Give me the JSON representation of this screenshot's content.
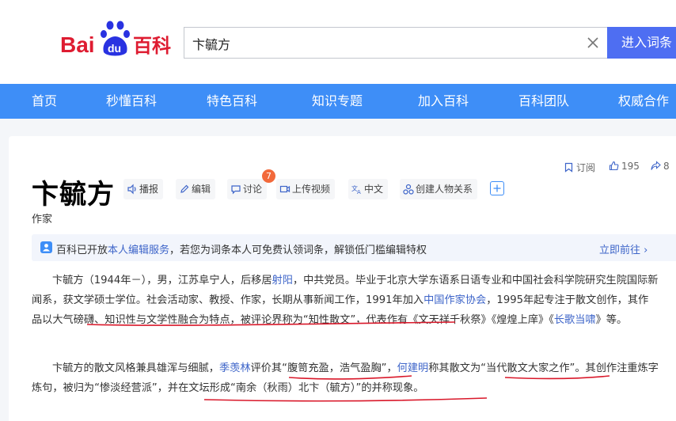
{
  "header": {
    "logo": {
      "brand_bai": "Bai",
      "brand_du": "du",
      "brand_suffix": "百科"
    },
    "search": {
      "value": "卞毓方"
    },
    "search_button": "进入词条"
  },
  "nav": {
    "items": [
      {
        "label": "首页"
      },
      {
        "label": "秒懂百科"
      },
      {
        "label": "特色百科"
      },
      {
        "label": "知识专题"
      },
      {
        "label": "加入百科"
      },
      {
        "label": "百科团队"
      },
      {
        "label": "权威合作"
      }
    ]
  },
  "entry": {
    "title": "卞毓方",
    "subtitle": "作家",
    "tools": {
      "broadcast": "播报",
      "edit": "编辑",
      "discuss": "讨论",
      "discuss_badge": "7",
      "upload": "上传视频",
      "translate": "中文",
      "relation": "创建人物关系"
    },
    "meta": {
      "subscribe": "订阅",
      "likes": "195",
      "shares": "8"
    }
  },
  "notice": {
    "prefix": "百科已开放",
    "link": "本人编辑服务",
    "suffix": "，若您为词条本人可免费认领词条，解锁低门槛编辑特权",
    "action": "立即前往"
  },
  "paragraphs": {
    "p1": {
      "t1": "卞毓方（1944年－），男，江苏阜宁人，后移居",
      "l1": "射阳",
      "t2": "，中共党员。毕业于北京大学东语系日语专业和中国社会科学院研究生院国际新闻系，获文学硕士学位。社会活动家、教授、作家，长期从事新闻工作，1991年加入",
      "l2": "中国作家协会",
      "t3": "，1995年起专注于散文创作，其作品以大气磅礴、知识性与文学性融合为特点，被评论界称为“知性散文”，代表作有《文天祥千秋祭》《煌煌上庠》《",
      "l3": "长歌当啸",
      "t4": "》等。"
    },
    "p2": {
      "t1": "卞毓方的散文风格兼具雄浑与细腻，",
      "l1": "季羡林",
      "t2": "评价其“腹笥充盈，浩气盈胸”，",
      "l2": "何建明",
      "t3": "称其散文为“当代散文大家之作”。其创作注重炼字炼句，被归为“惨淡经营派”，并在文坛形成“南余（秋雨）北卞（毓方）”的并称现象。"
    }
  },
  "colors": {
    "brand_red": "#de1c31",
    "brand_blue": "#2932e1",
    "nav_blue": "#3e8ef7",
    "search_blue": "#4e6ef2",
    "link_blue": "#3e65c9",
    "ink_red": "#d9182a"
  }
}
